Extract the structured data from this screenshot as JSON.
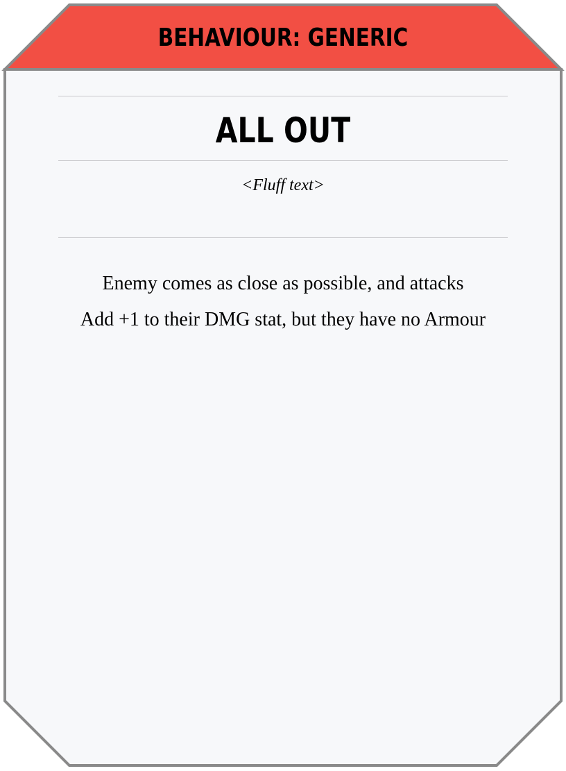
{
  "header": {
    "title": "BEHAVIOUR: GENERIC"
  },
  "card": {
    "title": "ALL OUT",
    "fluff": "<Fluff text>",
    "lines": [
      "Enemy comes as close as possible, and attacks",
      "Add +1 to their DMG stat, but they have no Armour"
    ]
  },
  "colors": {
    "header_fill": "#f24f44",
    "card_fill": "#f7f8fa",
    "border": "#8a8a8a",
    "rule": "#c9c9cc"
  }
}
